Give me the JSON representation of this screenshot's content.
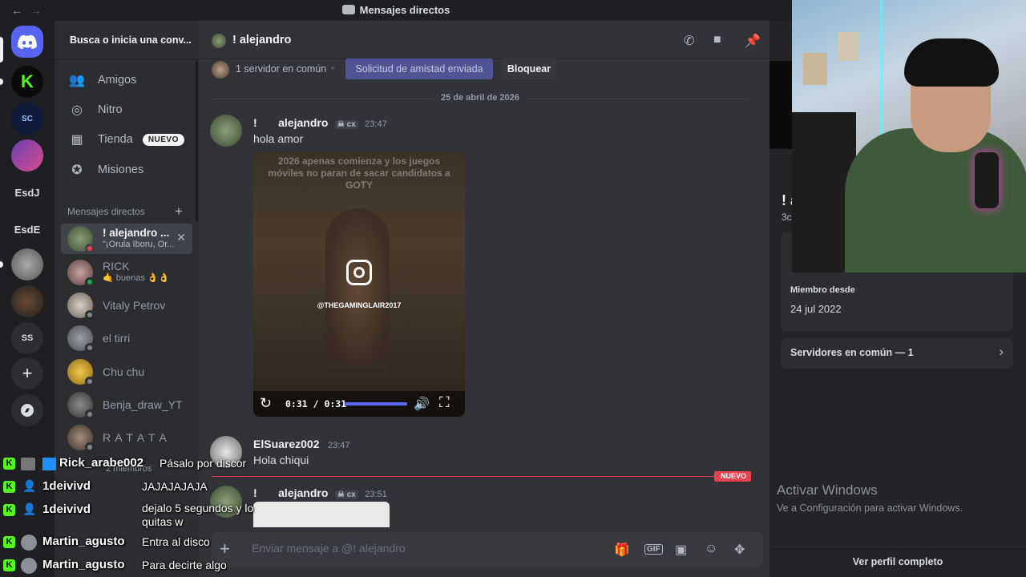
{
  "titlebar": {
    "back": "←",
    "forward": "→",
    "title": "Mensajes directos"
  },
  "servers": {
    "items": [
      {
        "label": "",
        "icon": "discord-logo-icon"
      },
      {
        "label": "",
        "icon": "kick-server-icon"
      },
      {
        "label": "",
        "icon": "starcraft-server-icon"
      },
      {
        "label": "",
        "icon": "capcut-server-icon"
      },
      {
        "label": "EsdJ",
        "icon": ""
      },
      {
        "label": "EsdE",
        "icon": ""
      },
      {
        "label": "",
        "icon": "server-avatar-icon"
      },
      {
        "label": "",
        "icon": "server-avatar-icon"
      },
      {
        "label": "SS",
        "icon": ""
      },
      {
        "label": "+",
        "icon": "add-server-icon"
      },
      {
        "label": "",
        "icon": "explore-icon"
      }
    ]
  },
  "dm_panel": {
    "search_label": "Busca o inicia una conv...",
    "nav": [
      {
        "label": "Amigos",
        "icon": "friends-icon"
      },
      {
        "label": "Nitro",
        "icon": "nitro-icon"
      },
      {
        "label": "Tienda",
        "icon": "shop-icon",
        "badge": "NUEVO"
      },
      {
        "label": "Misiones",
        "icon": "quests-icon"
      }
    ],
    "dm_header": "Mensajes directos",
    "dm_list": [
      {
        "name": "! alejandro ...",
        "sub": "\"¡Orula Iboru, Or...",
        "active": true
      },
      {
        "name": "RICK",
        "sub": "🤙 buenas 👌👌",
        "active": false
      },
      {
        "name": "Vitaly Petrov",
        "sub": "",
        "active": false
      },
      {
        "name": "el tirri",
        "sub": "",
        "active": false
      },
      {
        "name": "Chu chu",
        "sub": "",
        "active": false
      },
      {
        "name": "Benja_draw_YT",
        "sub": "",
        "active": false
      },
      {
        "name": "R A T A T A",
        "sub": "",
        "active": false
      },
      {
        "name": "2 miembros",
        "sub": "",
        "active": false
      }
    ]
  },
  "chat": {
    "channel_name": "! alejandro",
    "mutual": "1 servidor en común",
    "friend_request_label": "Solicitud de amistad enviada",
    "block_label": "Bloquear",
    "date_sep": "25 de abril de 2026",
    "messages": [
      {
        "author": "alejandro",
        "prefix": "!",
        "tag": "cx",
        "time": "23:47",
        "text": "hola amor"
      },
      {
        "author": "ElSuarez002",
        "prefix": "",
        "tag": "",
        "time": "23:47",
        "text": "Hola chiqui"
      },
      {
        "author": "alejandro",
        "prefix": "!",
        "tag": "cx",
        "time": "23:51",
        "text": ""
      }
    ],
    "video": {
      "caption": "2026 apenas comienza y los juegos móviles no paran de sacar candidatos a GOTY",
      "watermark": "@THEGAMINGLAIR2017",
      "time": "0:31 / 0:31",
      "progress": 1.0
    },
    "new_badge": "NUEVO",
    "composer_placeholder": "Enviar mensaje a @! alejandro"
  },
  "profile": {
    "name_partial": "! a",
    "sub_partial": "3c",
    "member_since_label": "Miembro desde",
    "member_since": "24 jul 2022",
    "mutual_servers": "Servidores en común — 1",
    "view_full": "Ver perfil completo",
    "windows_title": "Activar Windows",
    "windows_sub": "Ve a Configuración para activar Windows."
  },
  "overlay_chat": [
    {
      "user": "Rick_arabe002",
      "msg": "Pásalo por discor"
    },
    {
      "user": "1deivivd",
      "msg": "JAJAJAJAJA"
    },
    {
      "user": "1deivivd",
      "msg": "dejalo 5 segundos y lo quitas w"
    },
    {
      "user": "Martin_agusto",
      "msg": "Entra al disco"
    },
    {
      "user": "Martin_agusto",
      "msg": "Para decirte algo"
    }
  ],
  "colors": {
    "accent": "#5865f2",
    "kick": "#53fc18",
    "danger": "#e7434f",
    "bg_main": "#313338"
  }
}
